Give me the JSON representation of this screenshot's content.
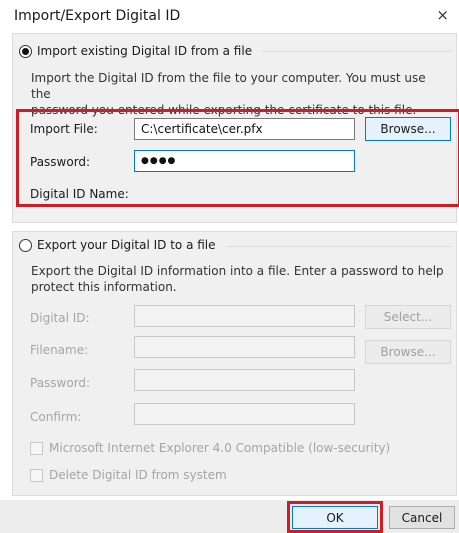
{
  "window": {
    "title": "Import/Export Digital ID",
    "close_glyph": "×"
  },
  "import_section": {
    "radio_label": "Import existing Digital ID from a file",
    "selected": true,
    "description_line1": "Import the Digital ID from the file to your computer. You must use the",
    "description_line2": "password you entered while exporting the certificate to this file.",
    "import_file_label": "Import File:",
    "import_file_value": "C:\\certificate\\cer.pfx",
    "browse_label": "Browse...",
    "password_label": "Password:",
    "password_value": "●●●●",
    "digital_id_name_label": "Digital ID Name:"
  },
  "export_section": {
    "radio_label": "Export your Digital ID to a file",
    "selected": false,
    "description_line1": "Export the Digital ID information into a file. Enter a password to help",
    "description_line2": "protect this information.",
    "digital_id_label": "Digital ID:",
    "select_label": "Select...",
    "filename_label": "Filename:",
    "browse_label": "Browse...",
    "password_label": "Password:",
    "confirm_label": "Confirm:",
    "ie_compat_label": "Microsoft Internet Explorer 4.0 Compatible (low-security)",
    "delete_label": "Delete Digital ID from system"
  },
  "footer": {
    "ok_label": "OK",
    "cancel_label": "Cancel"
  },
  "colors": {
    "highlight": "#d01c24",
    "accent": "#0078d7"
  }
}
